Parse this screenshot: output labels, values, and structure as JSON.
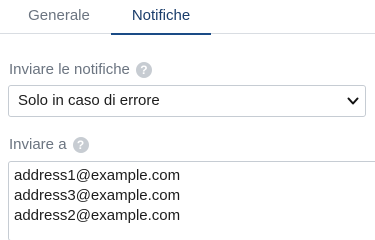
{
  "tabs": [
    {
      "label": "Generale",
      "active": false
    },
    {
      "label": "Notifiche",
      "active": true
    }
  ],
  "colors": {
    "active_tab_underline": "#1a4b86",
    "label_text": "#6b7480",
    "border": "#c6ccd3"
  },
  "notify_field": {
    "label": "Inviare le notifiche",
    "help_icon": "question-circle-icon",
    "selected_value": "Solo in caso di errore"
  },
  "send_to_field": {
    "label": "Inviare a",
    "help_icon": "question-circle-icon",
    "addresses": [
      "address1@example.com",
      "address3@example.com",
      "address2@example.com"
    ]
  }
}
